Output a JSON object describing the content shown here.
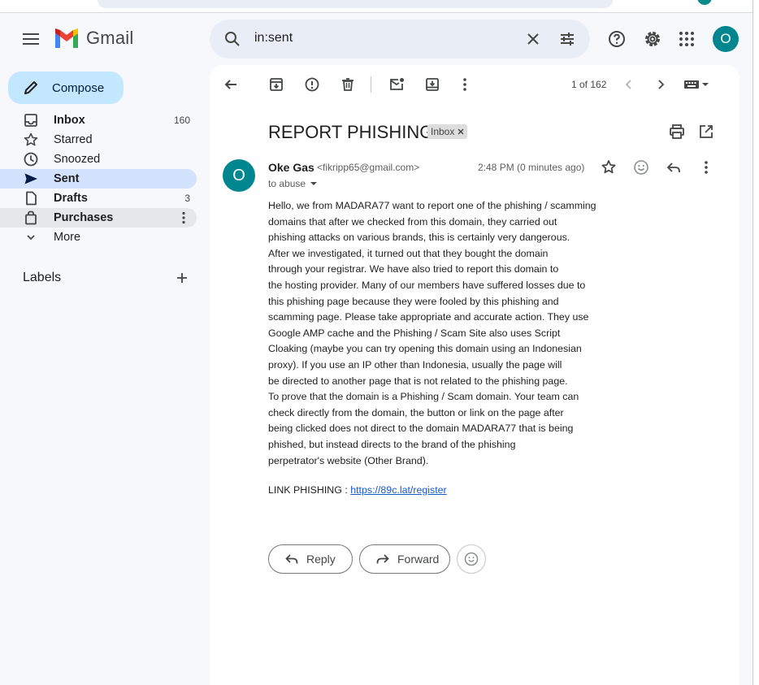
{
  "app": {
    "name": "Gmail"
  },
  "search": {
    "query": "in:sent"
  },
  "account": {
    "avatar_letter": "O"
  },
  "compose": {
    "label": "Compose"
  },
  "sidebar": {
    "items": [
      {
        "label": "Inbox",
        "count": "160",
        "icon": "inbox-icon"
      },
      {
        "label": "Starred",
        "count": "",
        "icon": "star-icon"
      },
      {
        "label": "Snoozed",
        "count": "",
        "icon": "clock-icon"
      },
      {
        "label": "Sent",
        "count": "",
        "icon": "send-icon"
      },
      {
        "label": "Drafts",
        "count": "3",
        "icon": "draft-icon"
      },
      {
        "label": "Purchases",
        "count": "",
        "icon": "shopping-bag-icon"
      },
      {
        "label": "More",
        "count": "",
        "icon": "chevron-down-icon"
      }
    ],
    "labels_title": "Labels"
  },
  "toolbar": {
    "pager": "1 of 162"
  },
  "email": {
    "subject": "REPORT PHISHING",
    "label_chip": "Inbox",
    "sender_initial": "O",
    "sender_name": "Oke Gas",
    "sender_email": "<fikripp65@gmail.com>",
    "recipient": "to abuse",
    "time": "2:48 PM (0 minutes ago)",
    "body_lines": [
      "Hello, we from MADARA77 want to report one of the phishing / scamming",
      "domains that after we checked from this domain, they carried out",
      "phishing attacks on various brands, this is certainly very dangerous.",
      "After we investigated, it turned out that they bought the domain",
      "through your registrar. We have also tried to report this domain to",
      "the hosting provider. Many of our members have suffered losses due to",
      "this phishing page because they were fooled by this phishing and",
      "scamming page. Please take appropriate and accurate action. They use",
      "Google AMP cache and the Phishing / Scam Site also uses Script",
      "Cloaking (maybe you can try opening this domain using an Indonesian",
      "proxy). If you use an IP other than Indonesia, usually the page will",
      "be directed to another page that is not related to the phishing page.",
      "To prove that the domain is a Phishing / Scam domain. Your team can",
      "check directly from the domain, the button or link on the page after",
      "being clicked does not direct to the domain MADARA77 that is being",
      "phished, but instead directs to the brand of the phishing",
      "perpetrator's website (Other Brand)."
    ],
    "link_prefix": "LINK PHISHING : ",
    "link_text": "https://89c.lat/register"
  },
  "actions": {
    "reply_label": "Reply",
    "forward_label": "Forward"
  },
  "colors": {
    "accent": "#c2e7ff",
    "avatar": "#00868f",
    "active_nav": "#d3e3fd",
    "link": "#1a57c9"
  }
}
